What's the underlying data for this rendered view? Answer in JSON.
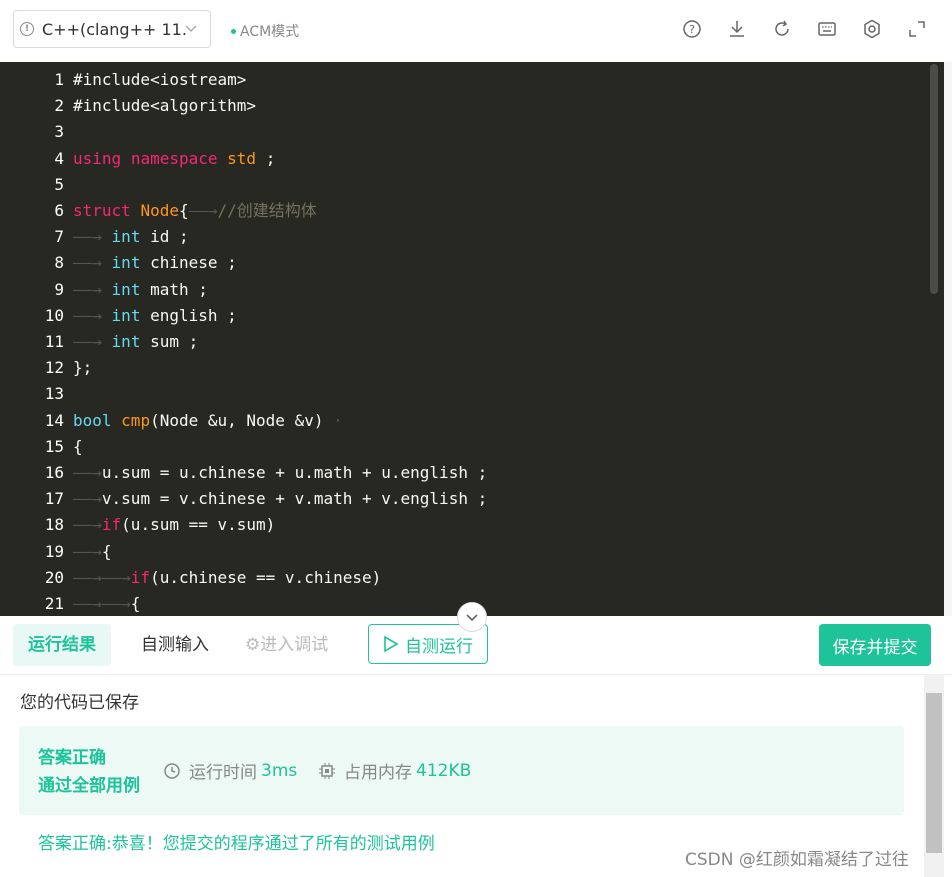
{
  "toolbar": {
    "language": "C++(clang++ 11.",
    "mode": "ACM模式",
    "icons": [
      "help-icon",
      "download-icon",
      "refresh-icon",
      "keyboard-icon",
      "settings-icon",
      "fullscreen-icon"
    ]
  },
  "editor": {
    "lines": [
      {
        "n": "1",
        "tokens": [
          [
            "",
            "#include<iostream>"
          ]
        ]
      },
      {
        "n": "2",
        "tokens": [
          [
            "",
            "#include<algorithm>"
          ]
        ]
      },
      {
        "n": "3",
        "tokens": []
      },
      {
        "n": "4",
        "tokens": [
          [
            "kw",
            "using"
          ],
          [
            "",
            " "
          ],
          [
            "kw",
            "namespace"
          ],
          [
            "",
            " "
          ],
          [
            "fn",
            "std"
          ],
          [
            "",
            " ;"
          ]
        ]
      },
      {
        "n": "5",
        "tokens": []
      },
      {
        "n": "6",
        "tokens": [
          [
            "kw",
            "struct"
          ],
          [
            "",
            " "
          ],
          [
            "fn",
            "Node"
          ],
          [
            "",
            "{"
          ],
          [
            "tabarrow",
            "——→"
          ],
          [
            "cm",
            "//创建结构体"
          ]
        ]
      },
      {
        "n": "7",
        "tokens": [
          [
            "tabarrow",
            "——→"
          ],
          [
            "",
            " "
          ],
          [
            "ty",
            "int"
          ],
          [
            "",
            " id ;"
          ]
        ]
      },
      {
        "n": "8",
        "tokens": [
          [
            "tabarrow",
            "——→"
          ],
          [
            "",
            " "
          ],
          [
            "ty",
            "int"
          ],
          [
            "",
            " chinese ;"
          ]
        ]
      },
      {
        "n": "9",
        "tokens": [
          [
            "tabarrow",
            "——→"
          ],
          [
            "",
            " "
          ],
          [
            "ty",
            "int"
          ],
          [
            "",
            " math ;"
          ]
        ]
      },
      {
        "n": "10",
        "tokens": [
          [
            "tabarrow",
            "——→"
          ],
          [
            "",
            " "
          ],
          [
            "ty",
            "int"
          ],
          [
            "",
            " english ;"
          ]
        ]
      },
      {
        "n": "11",
        "tokens": [
          [
            "tabarrow",
            "——→"
          ],
          [
            "",
            " "
          ],
          [
            "ty",
            "int"
          ],
          [
            "",
            " sum ;"
          ]
        ]
      },
      {
        "n": "12",
        "tokens": [
          [
            "",
            "};"
          ]
        ]
      },
      {
        "n": "13",
        "tokens": []
      },
      {
        "n": "14",
        "tokens": [
          [
            "ty",
            "bool"
          ],
          [
            "",
            " "
          ],
          [
            "fn",
            "cmp"
          ],
          [
            "",
            "(Node &u, Node &v) "
          ],
          [
            "tabarrow",
            "·"
          ]
        ]
      },
      {
        "n": "15",
        "tokens": [
          [
            "",
            "{"
          ]
        ]
      },
      {
        "n": "16",
        "tokens": [
          [
            "tabarrow",
            "——→"
          ],
          [
            "",
            "u.sum = u.chinese + u.math + u.english ;"
          ]
        ]
      },
      {
        "n": "17",
        "tokens": [
          [
            "tabarrow",
            "——→"
          ],
          [
            "",
            "v.sum = v.chinese + v.math + v.english ;"
          ]
        ]
      },
      {
        "n": "18",
        "tokens": [
          [
            "tabarrow",
            "——→"
          ],
          [
            "kw",
            "if"
          ],
          [
            "",
            "(u.sum == v.sum)"
          ]
        ]
      },
      {
        "n": "19",
        "tokens": [
          [
            "tabarrow",
            "——→"
          ],
          [
            "",
            "{"
          ]
        ]
      },
      {
        "n": "20",
        "tokens": [
          [
            "tabarrow",
            "——→——→"
          ],
          [
            "kw",
            "if"
          ],
          [
            "",
            "(u.chinese == v.chinese)"
          ]
        ]
      },
      {
        "n": "21",
        "tokens": [
          [
            "tabarrow",
            "——→——→"
          ],
          [
            "",
            "{"
          ]
        ]
      }
    ]
  },
  "bottom": {
    "tab_results": "运行结果",
    "tab_input": "自测输入",
    "tab_debug": "进入调试",
    "run_label": "自测运行",
    "submit_label": "保存并提交"
  },
  "results": {
    "saved": "您的代码已保存",
    "status_line1": "答案正确",
    "status_line2": "通过全部用例",
    "runtime_label": "运行时间",
    "runtime_value": "3ms",
    "memory_label": "占用内存",
    "memory_value": "412KB",
    "message": "答案正确:恭喜！您提交的程序通过了所有的测试用例"
  },
  "watermark": "CSDN @红颜如霜凝结了过往",
  "colors": {
    "accent": "#1ec39a",
    "editor_bg": "#272822"
  }
}
